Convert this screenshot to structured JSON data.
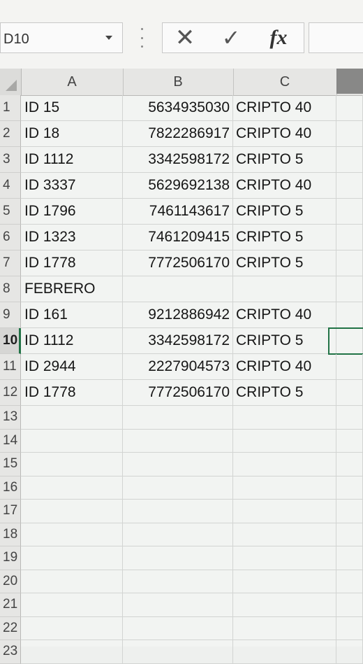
{
  "name_box": {
    "value": "D10"
  },
  "formula_bar": {
    "cancel_icon": "✕",
    "enter_icon": "✓",
    "fx_label": "fx",
    "value": ""
  },
  "columns": [
    "A",
    "B",
    "C"
  ],
  "rows": [
    {
      "num": "1",
      "a": "ID 15",
      "b": "5634935030",
      "c": "CRIPTO 40"
    },
    {
      "num": "2",
      "a": "ID 18",
      "b": "7822286917",
      "c": "CRIPTO 40"
    },
    {
      "num": "3",
      "a": "ID 1112",
      "b": "3342598172",
      "c": "CRIPTO 5"
    },
    {
      "num": "4",
      "a": "ID 3337",
      "b": "5629692138",
      "c": "CRIPTO 40"
    },
    {
      "num": "5",
      "a": "ID 1796",
      "b": "7461143617",
      "c": "CRIPTO 5"
    },
    {
      "num": "6",
      "a": "ID 1323",
      "b": "7461209415",
      "c": "CRIPTO 5"
    },
    {
      "num": "7",
      "a": "ID 1778",
      "b": "7772506170",
      "c": "CRIPTO 5"
    },
    {
      "num": "8",
      "a": "FEBRERO",
      "b": "",
      "c": ""
    },
    {
      "num": "9",
      "a": "ID 161",
      "b": "9212886942",
      "c": "CRIPTO 40"
    },
    {
      "num": "10",
      "a": "ID 1112",
      "b": "3342598172",
      "c": "CRIPTO 5"
    },
    {
      "num": "11",
      "a": "ID 2944",
      "b": "2227904573",
      "c": "CRIPTO 40"
    },
    {
      "num": "12",
      "a": "ID 1778",
      "b": "7772506170",
      "c": "CRIPTO 5"
    },
    {
      "num": "13",
      "a": "",
      "b": "",
      "c": ""
    },
    {
      "num": "14",
      "a": "",
      "b": "",
      "c": ""
    },
    {
      "num": "15",
      "a": "",
      "b": "",
      "c": ""
    },
    {
      "num": "16",
      "a": "",
      "b": "",
      "c": ""
    },
    {
      "num": "17",
      "a": "",
      "b": "",
      "c": ""
    },
    {
      "num": "18",
      "a": "",
      "b": "",
      "c": ""
    },
    {
      "num": "19",
      "a": "",
      "b": "",
      "c": ""
    },
    {
      "num": "20",
      "a": "",
      "b": "",
      "c": ""
    },
    {
      "num": "21",
      "a": "",
      "b": "",
      "c": ""
    },
    {
      "num": "22",
      "a": "",
      "b": "",
      "c": ""
    },
    {
      "num": "23",
      "a": "",
      "b": "",
      "c": ""
    }
  ],
  "active_row": "10",
  "accent_color": "#217346"
}
